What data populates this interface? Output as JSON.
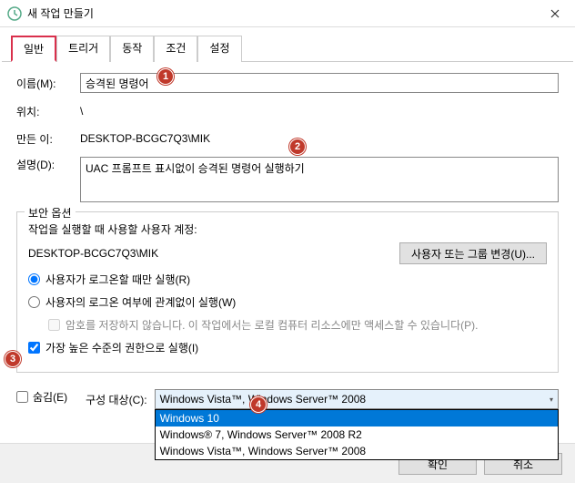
{
  "window": {
    "title": "새 작업 만들기"
  },
  "tabs": {
    "general": "일반",
    "triggers": "트리거",
    "actions": "동작",
    "conditions": "조건",
    "settings": "설정"
  },
  "labels": {
    "name": "이름(M):",
    "location": "위치:",
    "author": "만든 이:",
    "description": "설명(D):"
  },
  "values": {
    "name": "승격된 명령어",
    "location": "\\",
    "author": "DESKTOP-BCGC7Q3\\MIK",
    "description": "UAC 프롬프트 표시없이 승격된 명령어 실행하기"
  },
  "security": {
    "legend": "보안 옵션",
    "label_account": "작업을 실행할 때 사용할 사용자 계정:",
    "account": "DESKTOP-BCGC7Q3\\MIK",
    "change_button": "사용자 또는 그룹 변경(U)...",
    "radio_logged_on": "사용자가 로그온할 때만 실행(R)",
    "radio_any": "사용자의 로그온 여부에 관계없이 실행(W)",
    "check_nopw": "암호를 저장하지 않습니다. 이 작업에서는 로컬 컴퓨터 리소스에만 액세스할 수 있습니다(P).",
    "check_highest": "가장 높은 수준의 권한으로 실행(I)"
  },
  "bottom": {
    "hidden": "숨김(E)",
    "config_label": "구성 대상(C):",
    "selected": "Windows Vista™, Windows Server™ 2008",
    "options": {
      "win10": "Windows 10",
      "win7": "Windows® 7, Windows Server™ 2008 R2",
      "vista": "Windows Vista™, Windows Server™ 2008"
    }
  },
  "footer": {
    "ok": "확인",
    "cancel": "취소"
  },
  "badges": {
    "b1": "1",
    "b2": "2",
    "b3": "3",
    "b4": "4"
  }
}
